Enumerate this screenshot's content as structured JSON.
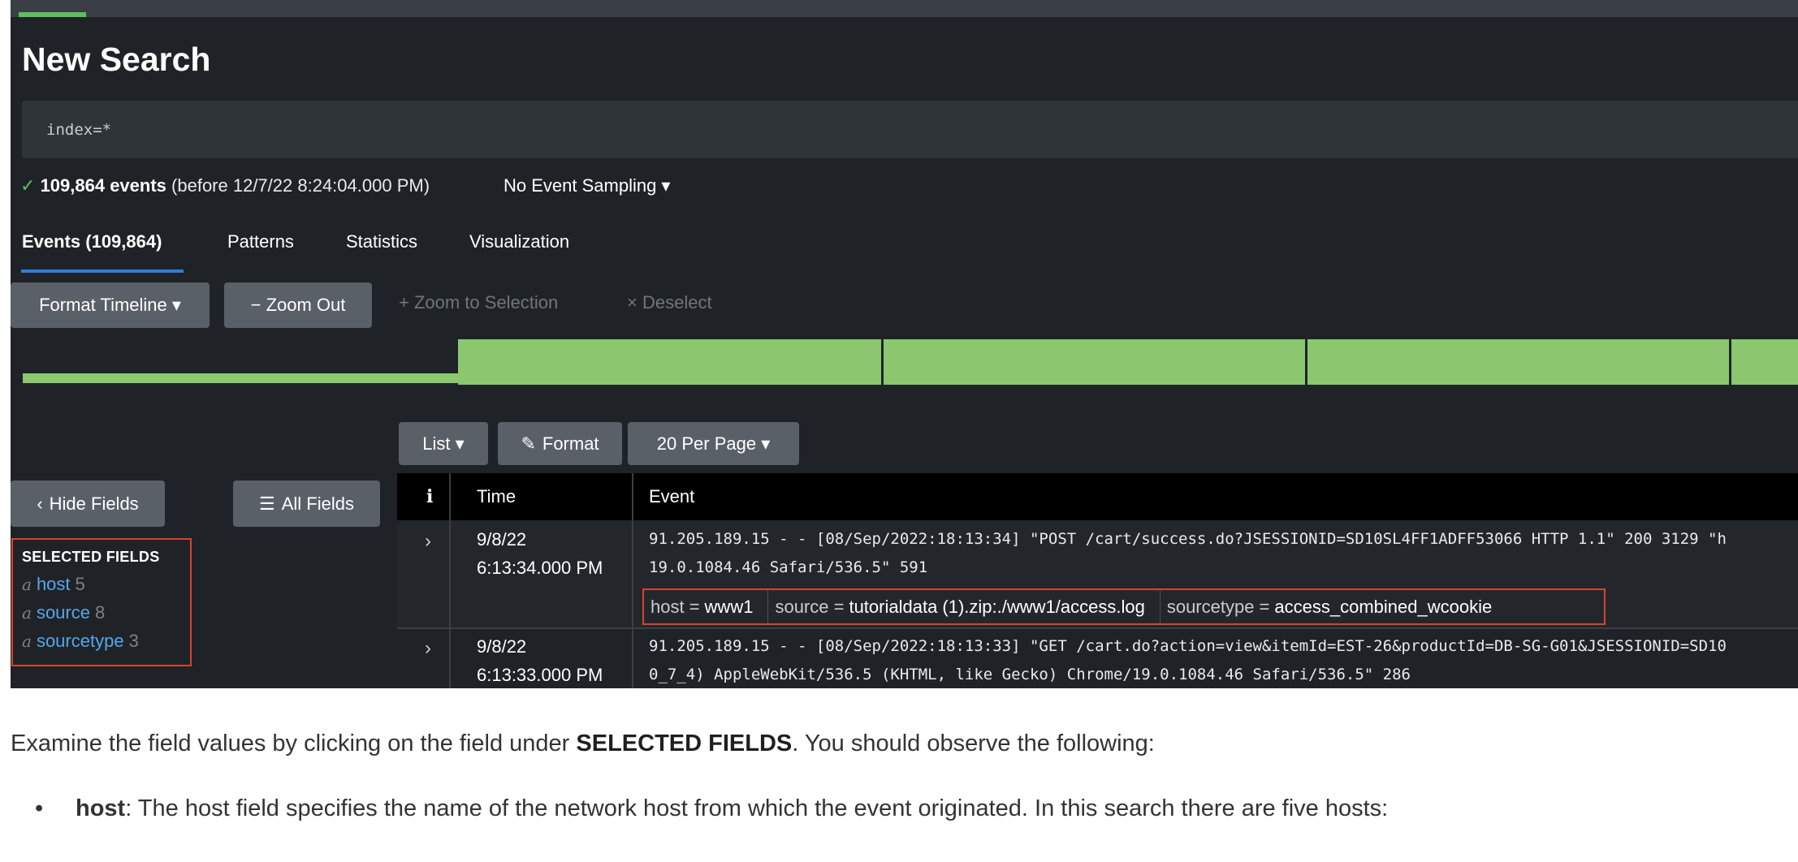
{
  "header": {
    "title": "New Search"
  },
  "search": {
    "value": "index=*"
  },
  "status": {
    "check": "✓",
    "count": "109,864 events",
    "before": "(before 12/7/22 8:24:04.000 PM)",
    "sampling": "No Event Sampling ▾"
  },
  "tabs": [
    "Events (109,864)",
    "Patterns",
    "Statistics",
    "Visualization"
  ],
  "timeline_toolbar": {
    "format": "Format Timeline ▾",
    "zoom_out": "− Zoom Out",
    "zoom_selection": "+ Zoom to Selection",
    "deselect": "× Deselect"
  },
  "results_toolbar": {
    "list": "List ▾",
    "format": "Format",
    "per_page": "20 Per Page ▾"
  },
  "sidebar": {
    "hide_fields": "Hide Fields",
    "all_fields": "All Fields",
    "selected_header": "SELECTED FIELDS",
    "fields": [
      {
        "type": "a",
        "name": "host",
        "count": "5"
      },
      {
        "type": "a",
        "name": "source",
        "count": "8"
      },
      {
        "type": "a",
        "name": "sourcetype",
        "count": "3"
      }
    ]
  },
  "table": {
    "headers": {
      "info": "i",
      "time": "Time",
      "event": "Event"
    },
    "rows": [
      {
        "date": "9/8/22",
        "time": "6:13:34.000 PM",
        "line1": "91.205.189.15 - - [08/Sep/2022:18:13:34] \"POST /cart/success.do?JSESSIONID=SD10SL4FF1ADFF53066 HTTP 1.1\" 200 3129 \"h",
        "line2": "19.0.1084.46 Safari/536.5\" 591",
        "fields": {
          "host_key": "host =",
          "host_val": "www1",
          "source_key": "source =",
          "source_val": "tutorialdata (1).zip:./www1/access.log",
          "sourcetype_key": "sourcetype =",
          "sourcetype_val": "access_combined_wcookie"
        }
      },
      {
        "date": "9/8/22",
        "time": "6:13:33.000 PM",
        "line1": "91.205.189.15 - - [08/Sep/2022:18:13:33] \"GET /cart.do?action=view&itemId=EST-26&productId=DB-SG-G01&JSESSIONID=SD10",
        "line2": "0_7_4) AppleWebKit/536.5 (KHTML, like Gecko) Chrome/19.0.1084.46 Safari/536.5\" 286"
      }
    ]
  },
  "doc": {
    "p1_before": "Examine the field values by clicking on the field under ",
    "p1_bold": "SELECTED FIELDS",
    "p1_after": ". You should observe the following:",
    "bullet_bold": "host",
    "bullet_rest": ": The host field specifies the name of the network host from which the event originated. In this search there are five hosts:"
  },
  "colors": {
    "accent_green": "#8ac76e",
    "highlight_red": "#d8432f",
    "link_blue": "#5aa5e8"
  }
}
